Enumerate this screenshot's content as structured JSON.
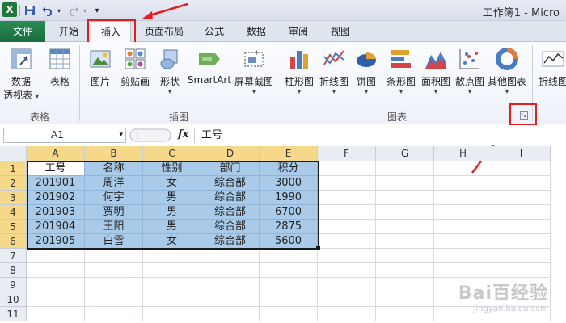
{
  "window": {
    "title": "工作簿1 - Micro"
  },
  "quick_access": {
    "save_icon": "save-icon",
    "undo_icon": "undo-icon",
    "redo_icon": "redo-icon",
    "customize_icon": "customize-qat-icon"
  },
  "tabs": [
    {
      "label": "文件"
    },
    {
      "label": "开始"
    },
    {
      "label": "插入"
    },
    {
      "label": "页面布局"
    },
    {
      "label": "公式"
    },
    {
      "label": "数据"
    },
    {
      "label": "审阅"
    },
    {
      "label": "视图"
    }
  ],
  "ribbon": {
    "tables": {
      "group": "表格",
      "pivot": "数据\n透视表",
      "pivot_line1": "数据",
      "pivot_line2": "透视表",
      "table": "表格"
    },
    "illustrations": {
      "group": "插图",
      "picture": "图片",
      "clipart": "剪贴画",
      "shapes": "形状",
      "smartart": "SmartArt",
      "screenshot": "屏幕截图"
    },
    "charts": {
      "group": "图表",
      "column": "柱形图",
      "line": "折线图",
      "pie": "饼图",
      "bar": "条形图",
      "area": "面积图",
      "scatter": "散点图",
      "other": "其他图表"
    },
    "sparklines": {
      "line": "折线图"
    }
  },
  "formula_bar": {
    "name_box": "A1",
    "fx": "fx",
    "content": "工号"
  },
  "grid": {
    "columns": [
      "A",
      "B",
      "C",
      "D",
      "E",
      "F",
      "G",
      "H",
      "I"
    ],
    "rows": [
      "1",
      "2",
      "3",
      "4",
      "5",
      "6",
      "7",
      "8",
      "9",
      "10",
      "11"
    ],
    "data": [
      [
        "工号",
        "名称",
        "性别",
        "部门",
        "积分"
      ],
      [
        "201901",
        "周洋",
        "女",
        "综合部",
        "3000"
      ],
      [
        "201902",
        "何宇",
        "男",
        "综合部",
        "1990"
      ],
      [
        "201903",
        "贾明",
        "男",
        "综合部",
        "6700"
      ],
      [
        "201904",
        "王阳",
        "男",
        "综合部",
        "2875"
      ],
      [
        "201905",
        "白雪",
        "女",
        "综合部",
        "5600"
      ]
    ]
  },
  "watermark": {
    "main": "Bai百经验",
    "sub": "jingyan.baidu.com"
  },
  "colors": {
    "file_tab": "#217346",
    "selection": "#a9cbe9",
    "header_selected": "#f6d88b",
    "annotation": "#e02020"
  }
}
